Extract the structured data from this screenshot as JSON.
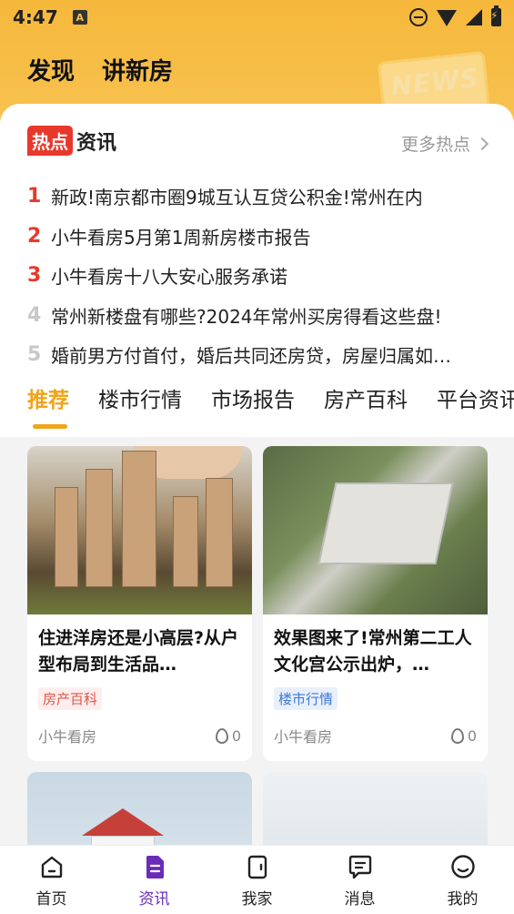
{
  "status_bar": {
    "time": "4:47",
    "notification_icon": "A"
  },
  "header": {
    "tabs": [
      "发现",
      "讲新房"
    ],
    "deco_text": "NEWS"
  },
  "hot_news": {
    "badge": "热点",
    "title": "资讯",
    "more_label": "更多热点",
    "items": [
      {
        "rank": "1",
        "text": "新政!南京都市圈9城互认互贷公积金!常州在内"
      },
      {
        "rank": "2",
        "text": "小牛看房5月第1周新房楼市报告"
      },
      {
        "rank": "3",
        "text": "小牛看房十八大安心服务承诺"
      },
      {
        "rank": "4",
        "text": "常州新楼盘有哪些?2024年常州买房得看这些盘!"
      },
      {
        "rank": "5",
        "text": "婚前男方付首付，婚后共同还房贷，房屋归属如…"
      }
    ]
  },
  "category_tabs": [
    "推荐",
    "楼市行情",
    "市场报告",
    "房产百科",
    "平台资讯"
  ],
  "feed": [
    {
      "title": " 住进洋房还是小高层?从户型布局到生活品…",
      "tag": "房产百科",
      "author": "小牛看房",
      "likes": "0"
    },
    {
      "title": "效果图来了!常州第二工人文化宫公示出炉，…",
      "tag": "楼市行情",
      "author": "小牛看房",
      "likes": "0"
    }
  ],
  "bottom_nav": [
    {
      "label": "首页",
      "icon": "home-icon"
    },
    {
      "label": "资讯",
      "icon": "news-icon"
    },
    {
      "label": "我家",
      "icon": "my-home-icon"
    },
    {
      "label": "消息",
      "icon": "message-icon"
    },
    {
      "label": "我的",
      "icon": "profile-icon"
    }
  ],
  "colors": {
    "accent_orange": "#f0a418",
    "hot_red": "#e8382b",
    "active_nav": "#6a2bb8"
  }
}
